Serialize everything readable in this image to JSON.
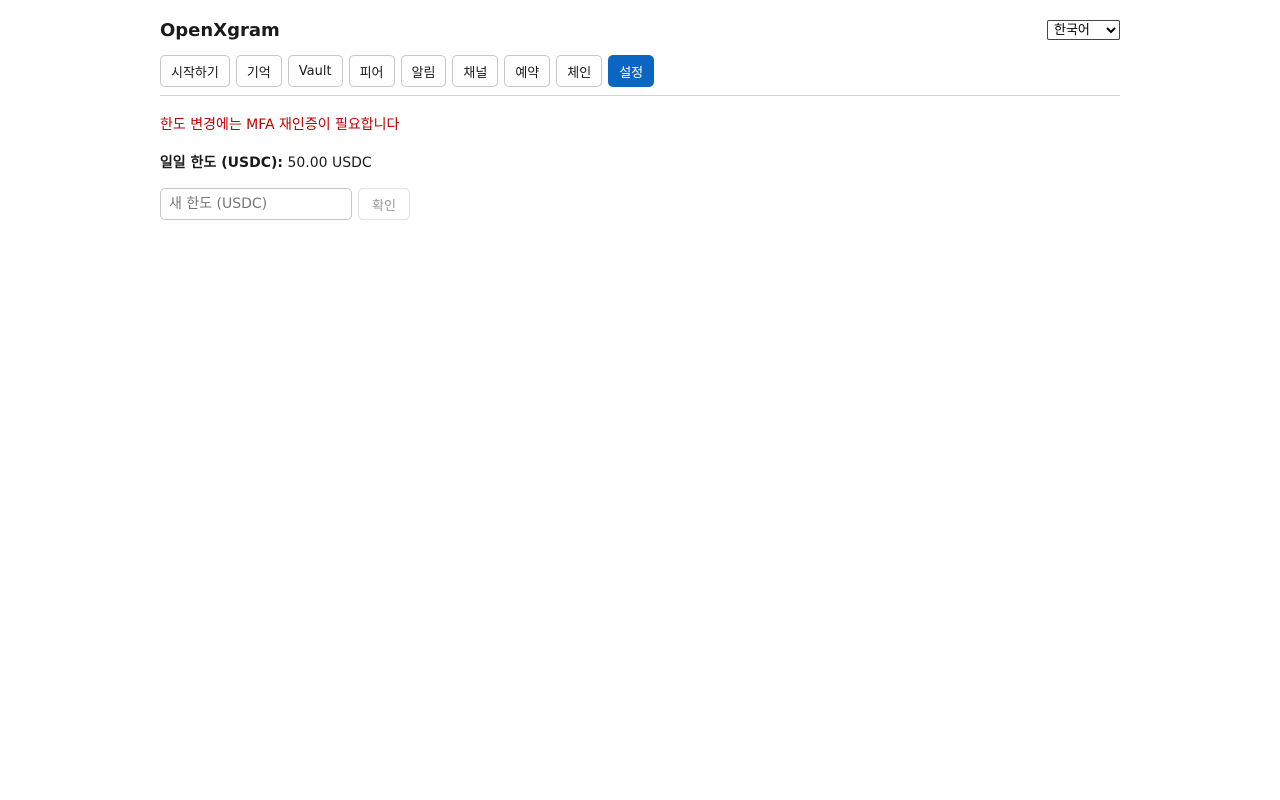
{
  "header": {
    "title": "OpenXgram",
    "language": {
      "selected": "한국어",
      "options": [
        "한국어"
      ]
    }
  },
  "tabs": [
    {
      "label": "시작하기",
      "active": false
    },
    {
      "label": "기억",
      "active": false
    },
    {
      "label": "Vault",
      "active": false
    },
    {
      "label": "피어",
      "active": false
    },
    {
      "label": "알림",
      "active": false
    },
    {
      "label": "채널",
      "active": false
    },
    {
      "label": "예약",
      "active": false
    },
    {
      "label": "체인",
      "active": false
    },
    {
      "label": "설정",
      "active": true
    }
  ],
  "settings": {
    "mfa_warning": "한도 변경에는 MFA 재인증이 필요합니다",
    "daily_limit_label": "일일 한도 (USDC):",
    "daily_limit_value": "50.00 USDC",
    "new_limit_placeholder": "새 한도 (USDC)",
    "new_limit_value": "",
    "confirm_label": "확인",
    "confirm_disabled": true
  },
  "colors": {
    "accent": "#0a66c2",
    "warning": "#c00000"
  }
}
